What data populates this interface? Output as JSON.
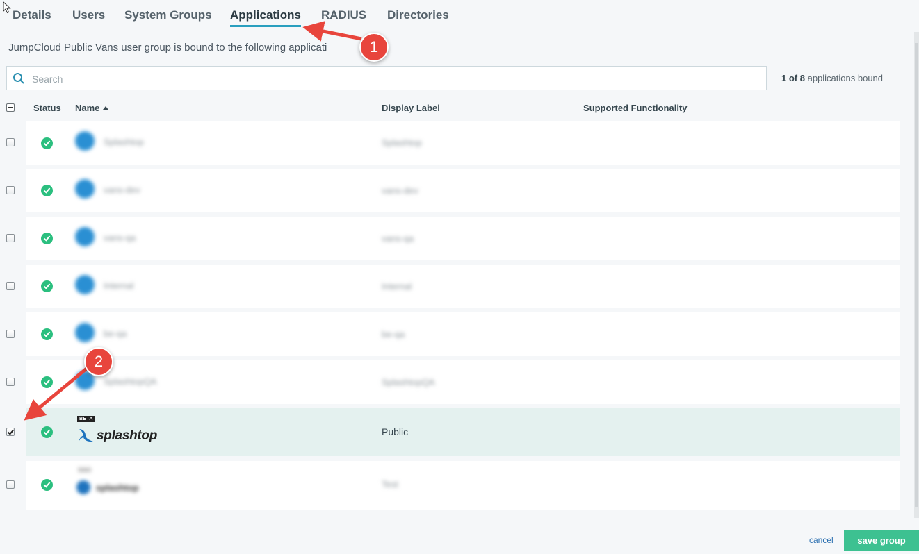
{
  "tabs": [
    {
      "label": "Details"
    },
    {
      "label": "Users"
    },
    {
      "label": "System Groups"
    },
    {
      "label": "Applications",
      "active": true
    },
    {
      "label": "RADIUS"
    },
    {
      "label": "Directories"
    }
  ],
  "subtitle": "JumpCloud Public Vans user group is bound to the following applicati",
  "search": {
    "placeholder": "Search",
    "value": ""
  },
  "bound": {
    "count": "1 of 8",
    "suffix": "applications bound"
  },
  "columns": {
    "status": "Status",
    "name": "Name",
    "display_label": "Display Label",
    "supported_functionality": "Supported Functionality"
  },
  "rows": [
    {
      "name": "Splashtop",
      "display_label": "Splashtop",
      "checked": false,
      "status": "active"
    },
    {
      "name": "vans-dev",
      "display_label": "vans-dev",
      "checked": false,
      "status": "active"
    },
    {
      "name": "vans-qa",
      "display_label": "vans-qa",
      "checked": false,
      "status": "active"
    },
    {
      "name": "Internal",
      "display_label": "Internal",
      "checked": false,
      "status": "active"
    },
    {
      "name": "be-qa",
      "display_label": "be-qa",
      "checked": false,
      "status": "active"
    },
    {
      "name": "SplashtopQA",
      "display_label": "SplashtopQA",
      "checked": false,
      "status": "active"
    },
    {
      "name": "splashtop",
      "badge": "BETA",
      "display_label": "Public",
      "checked": true,
      "status": "active"
    },
    {
      "name": "splashtop",
      "badge": "SSO",
      "display_label": "Test",
      "checked": false,
      "status": "active"
    }
  ],
  "footer": {
    "cancel": "cancel",
    "save": "save group"
  },
  "callouts": [
    "1",
    "2"
  ],
  "colors": {
    "accent": "#2a9fbf",
    "status_ok": "#2bbf7f",
    "save": "#3dc191",
    "callout": "#e8453c",
    "selected_row": "#e4f1ef"
  }
}
